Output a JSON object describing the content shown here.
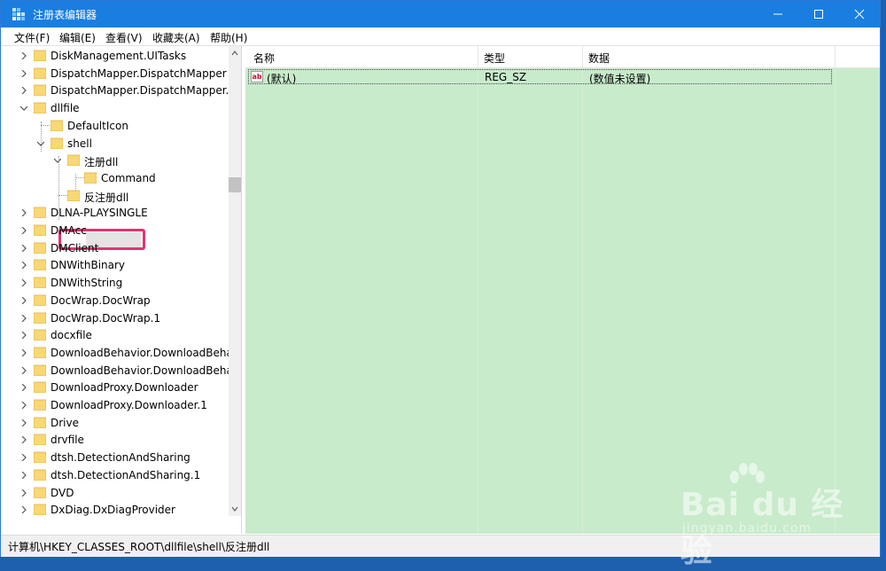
{
  "window": {
    "title": "注册表编辑器",
    "title_color": "#1a7ee0"
  },
  "menu": [
    "文件(F)",
    "编辑(E)",
    "查看(V)",
    "收藏夹(A)",
    "帮助(H)"
  ],
  "tree": {
    "items": [
      {
        "label": "DiskManagement.UITasks",
        "expander": "right"
      },
      {
        "label": "DispatchMapper.DispatchMapper",
        "expander": "right"
      },
      {
        "label": "DispatchMapper.DispatchMapper.",
        "expander": "right"
      },
      {
        "label": "dllfile",
        "expander": "down"
      },
      {
        "label": "DefaultIcon",
        "expander": "none"
      },
      {
        "label": "shell",
        "expander": "down"
      },
      {
        "label": "注册dll",
        "expander": "down"
      },
      {
        "label": "Command",
        "expander": "none"
      },
      {
        "label": "反注册dll",
        "expander": "none",
        "selected": true
      },
      {
        "label": "DLNA-PLAYSINGLE",
        "expander": "right"
      },
      {
        "label": "DMAcc",
        "expander": "right"
      },
      {
        "label": "DMClient",
        "expander": "right"
      },
      {
        "label": "DNWithBinary",
        "expander": "right"
      },
      {
        "label": "DNWithString",
        "expander": "right"
      },
      {
        "label": "DocWrap.DocWrap",
        "expander": "right"
      },
      {
        "label": "DocWrap.DocWrap.1",
        "expander": "right"
      },
      {
        "label": "docxfile",
        "expander": "right"
      },
      {
        "label": "DownloadBehavior.DownloadBeha",
        "expander": "right"
      },
      {
        "label": "DownloadBehavior.DownloadBeha",
        "expander": "right"
      },
      {
        "label": "DownloadProxy.Downloader",
        "expander": "right"
      },
      {
        "label": "DownloadProxy.Downloader.1",
        "expander": "right"
      },
      {
        "label": "Drive",
        "expander": "right"
      },
      {
        "label": "drvfile",
        "expander": "right"
      },
      {
        "label": "dtsh.DetectionAndSharing",
        "expander": "right"
      },
      {
        "label": "dtsh.DetectionAndSharing.1",
        "expander": "right"
      },
      {
        "label": "DVD",
        "expander": "right"
      },
      {
        "label": "DxDiag.DxDiagProvider",
        "expander": "right"
      }
    ]
  },
  "list": {
    "columns": [
      "名称",
      "类型",
      "数据"
    ],
    "rows": [
      {
        "name": "(默认)",
        "type": "REG_SZ",
        "data": "(数值未设置)"
      }
    ],
    "background": "#c8ebcb"
  },
  "status": {
    "path": "计算机\\HKEY_CLASSES_ROOT\\dllfile\\shell\\反注册dll"
  },
  "watermark": {
    "main": "Bai du 经验",
    "sub": "jingyan.baidu.com"
  },
  "highlight_color": "#e5336f"
}
